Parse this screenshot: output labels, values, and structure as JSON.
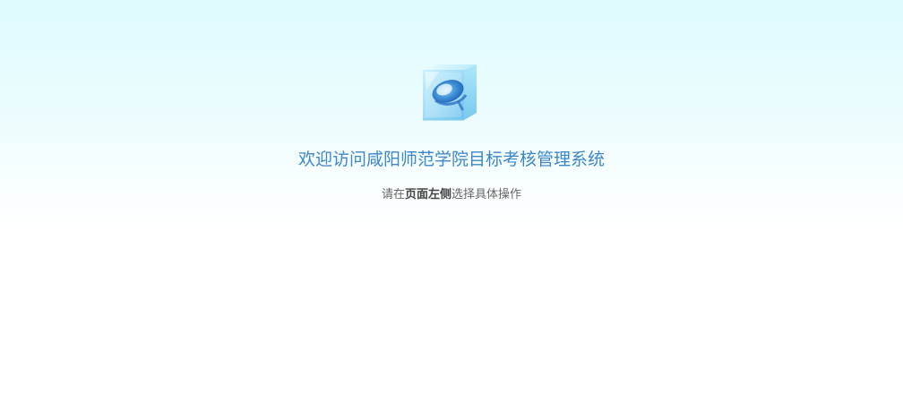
{
  "welcome": {
    "title": "欢迎访问咸阳师范学院目标考核管理系统",
    "hint_prefix": "请在",
    "hint_emphasis": "页面左侧",
    "hint_suffix": "选择具体操作"
  },
  "icons": {
    "logo": "crystal-cube-logo-icon"
  },
  "colors": {
    "title": "#3d86c8",
    "hint": "#666666",
    "background_top": "#dffbfd",
    "background_bottom": "#ffffff"
  }
}
